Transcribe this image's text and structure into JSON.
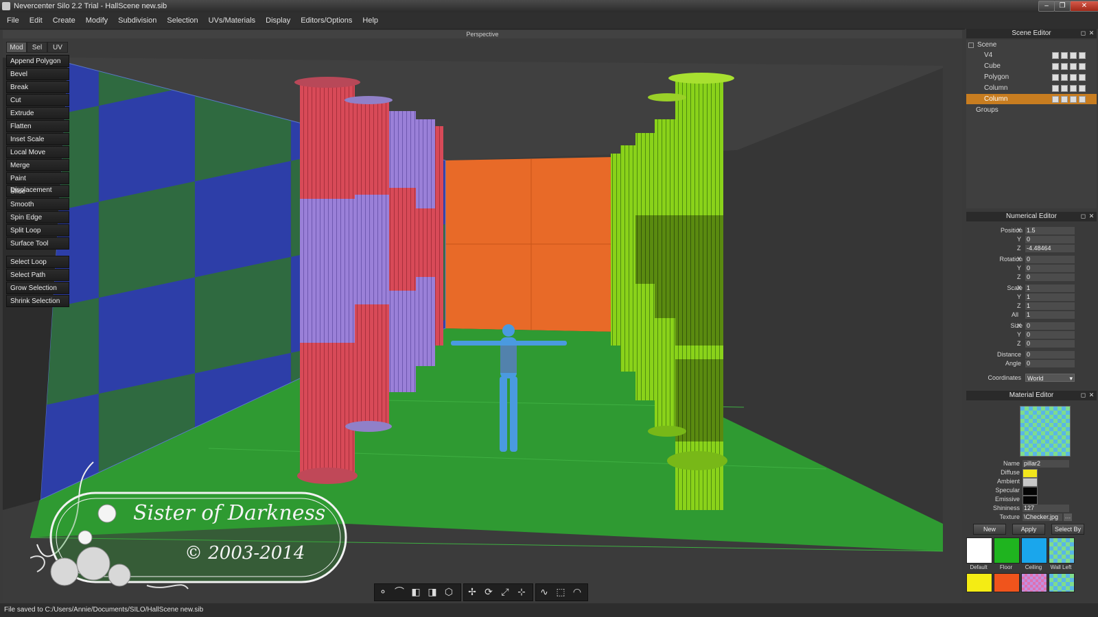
{
  "window": {
    "title": "Nevercenter Silo 2.2 Trial - HallScene new.sib",
    "controls": [
      "–",
      "❐",
      "✕"
    ]
  },
  "menu": [
    "File",
    "Edit",
    "Create",
    "Modify",
    "Subdivision",
    "Selection",
    "UVs/Materials",
    "Display",
    "Editors/Options",
    "Help"
  ],
  "viewport": {
    "label": "Perspective",
    "watermark_line1": "Sister of Darkness",
    "watermark_line2": "© 2003-2014"
  },
  "tool_tabs": [
    "Mod",
    "Sel",
    "UV"
  ],
  "tools_modify": [
    "Append Polygon",
    "Bevel",
    "Break",
    "Cut",
    "Extrude",
    "Flatten",
    "Inset Scale",
    "Local Move",
    "Merge",
    "Paint Displacement",
    "Slide",
    "Smooth",
    "Spin Edge",
    "Split Loop",
    "Surface Tool"
  ],
  "tools_select": [
    "Select Loop",
    "Select Path",
    "Grow Selection",
    "Shrink Selection"
  ],
  "status": "File saved to C:/Users/Annie/Documents/SILO/HallScene new.sib",
  "scene_editor": {
    "title": "Scene Editor",
    "root": "Scene",
    "objects": [
      "V4",
      "Cube",
      "Polygon",
      "Column",
      "Column"
    ],
    "selected_index": 4,
    "groups": "Groups"
  },
  "numerical_editor": {
    "title": "Numerical Editor",
    "position": {
      "label": "Position",
      "x": "1.5",
      "y": "0",
      "z": "-4.48464"
    },
    "rotation": {
      "label": "Rotation",
      "x": "0",
      "y": "0",
      "z": "0"
    },
    "scale": {
      "label": "Scale",
      "x": "1",
      "y": "1",
      "z": "1",
      "all": "1"
    },
    "size": {
      "label": "Size",
      "x": "0",
      "y": "0",
      "z": "0"
    },
    "distance": {
      "label": "Distance",
      "value": "0"
    },
    "angle": {
      "label": "Angle",
      "value": "0"
    },
    "coordinates": {
      "label": "Coordinates",
      "value": "World"
    }
  },
  "material_editor": {
    "title": "Material Editor",
    "name_label": "Name",
    "name": "pillar2",
    "diffuse_label": "Diffuse",
    "ambient_label": "Ambient",
    "specular_label": "Specular",
    "emissive_label": "Emissive",
    "shininess_label": "Shininess",
    "shininess": "127",
    "texture_label": "Texture",
    "texture": "\\Checker.jpg",
    "buttons": [
      "New",
      "Apply",
      "Select By"
    ],
    "swatches": [
      "Default",
      "Floor",
      "Ceiling",
      "Wall Left"
    ],
    "colors": {
      "diffuse": "#f2e61c",
      "ambient": "#c8c8c8",
      "specular": "#050505",
      "emissive": "#050505"
    }
  }
}
